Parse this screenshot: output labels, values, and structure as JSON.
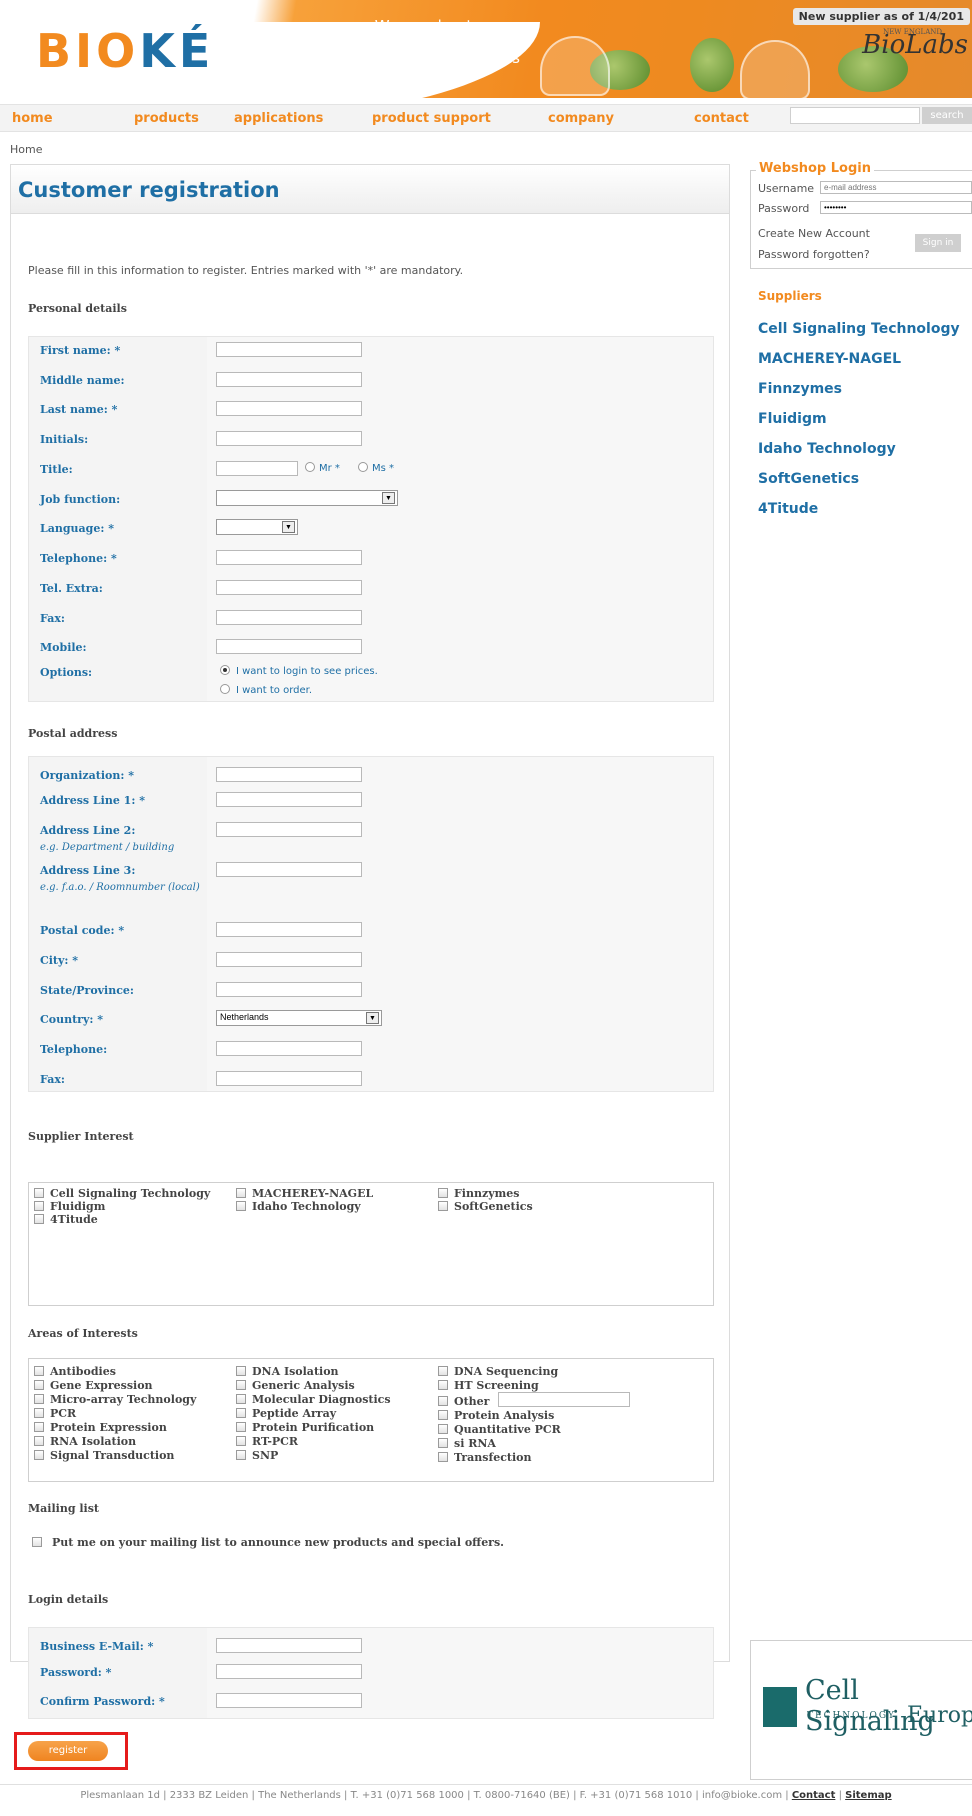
{
  "header": {
    "logo_part1": "BIO",
    "logo_part2": "KÉ",
    "tagline": "We accelerate your progress in R&D and Diagnostics",
    "supplier_note": "New supplier as of 1/4/201",
    "partner_brand": "BioLabs",
    "partner_small": "NEW ENGLAND"
  },
  "nav": {
    "items": [
      "home",
      "products",
      "applications",
      "product support",
      "company",
      "contact"
    ],
    "search_button": "search"
  },
  "breadcrumb": "Home",
  "page": {
    "title": "Customer registration",
    "intro": "Please fill in this information to register. Entries marked with '*' are mandatory."
  },
  "personal": {
    "section": "Personal details",
    "fields": [
      "First name: *",
      "Middle name:",
      "Last name: *",
      "Initials:",
      "Title:",
      "Job function:",
      "Language: *",
      "Telephone: *",
      "Tel. Extra:",
      "Fax:",
      "Mobile:",
      "Options:"
    ],
    "title_options": [
      "Mr *",
      "Ms *"
    ],
    "options": [
      "I want to login to see prices.",
      "I want to order."
    ]
  },
  "postal": {
    "section": "Postal address",
    "fields": [
      "Organization: *",
      "Address Line 1: *",
      "Address Line 2:",
      "Address Line 3:",
      "Postal code: *",
      "City: *",
      "State/Province:",
      "Country: *",
      "Telephone:",
      "Fax:"
    ],
    "hint2": "e.g. Department / building",
    "hint3": "e.g. f.a.o. / Roomnumber (local)",
    "country_value": "Netherlands"
  },
  "supplier_interest": {
    "section": "Supplier Interest",
    "items": [
      "Cell Signaling Technology",
      "MACHEREY-NAGEL",
      "Finnzymes",
      "Fluidigm",
      "Idaho Technology",
      "SoftGenetics",
      "4Titude"
    ]
  },
  "areas": {
    "section": "Areas of Interests",
    "col1": [
      "Antibodies",
      "Gene Expression",
      "Micro-array Technology",
      "PCR",
      "Protein Expression",
      "RNA Isolation",
      "Signal Transduction"
    ],
    "col2": [
      "DNA Isolation",
      "Generic Analysis",
      "Molecular Diagnostics",
      "Peptide Array",
      "Protein Purification",
      "RT-PCR",
      "SNP"
    ],
    "col3": [
      "DNA Sequencing",
      "HT Screening",
      "Other",
      "Protein Analysis",
      "Quantitative PCR",
      "si RNA",
      "Transfection"
    ]
  },
  "mailing": {
    "section": "Mailing list",
    "label": "Put me on your mailing list to announce new products and special offers."
  },
  "login": {
    "section": "Login details",
    "fields": [
      "Business E-Mail: *",
      "Password: *",
      "Confirm Password: *"
    ]
  },
  "register_label": "register",
  "footer": {
    "text": "Plesmanlaan 1d | 2333 BZ Leiden | The Netherlands | T. +31 (0)71 568 1000 | T. 0800-71640 (BE) | F. +31 (0)71 568 1010 | info@bioke.com | ",
    "contact": "Contact",
    "sep": " | ",
    "sitemap": "Sitemap"
  },
  "sidebar": {
    "webshop_title": "Webshop Login",
    "username_label": "Username",
    "username_placeholder": "e-mail address",
    "password_label": "Password",
    "password_value": "••••••••",
    "create_account": "Create New Account",
    "forgot": "Password forgotten?",
    "signin": "Sign in",
    "suppliers_title": "Suppliers",
    "suppliers": [
      "Cell Signaling Technology",
      "MACHEREY-NAGEL",
      "Finnzymes",
      "Fluidigm",
      "Idaho Technology",
      "SoftGenetics",
      "4Titude"
    ],
    "ad_brand": "Cell Signaling",
    "ad_sub": "TECHNOLOGY",
    "ad_region": "Europe"
  },
  "colors": {
    "orange": "#f28a1f",
    "blue": "#1f6fa5",
    "highlight": "#e51b1b"
  }
}
